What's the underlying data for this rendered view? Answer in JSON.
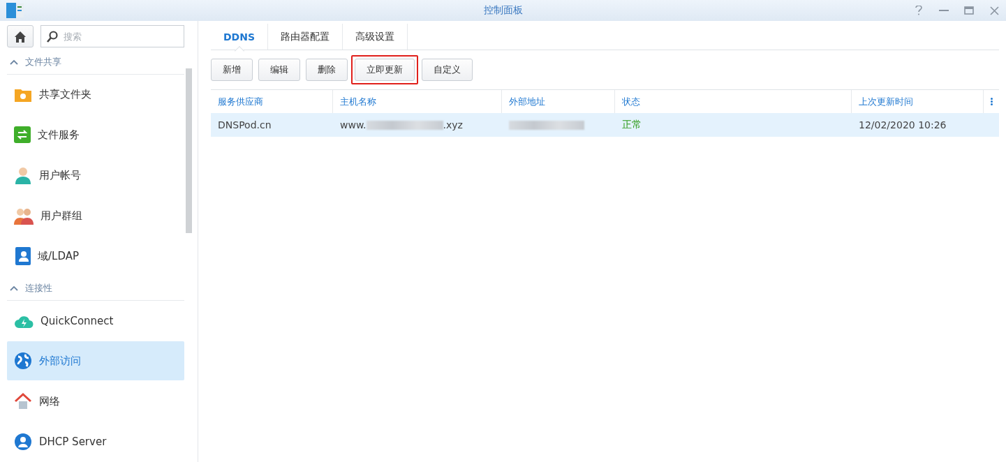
{
  "window": {
    "title": "控制面板"
  },
  "search": {
    "placeholder": "搜索"
  },
  "sidebar": {
    "sections": [
      {
        "header": "文件共享",
        "expanded": true,
        "items": [
          {
            "label": "共享文件夹",
            "selected": false
          },
          {
            "label": "文件服务",
            "selected": false
          },
          {
            "label": "用户帐号",
            "selected": false
          },
          {
            "label": "用户群组",
            "selected": false
          },
          {
            "label": "域/LDAP",
            "selected": false
          }
        ]
      },
      {
        "header": "连接性",
        "expanded": true,
        "items": [
          {
            "label": "QuickConnect",
            "selected": false
          },
          {
            "label": "外部访问",
            "selected": true
          },
          {
            "label": "网络",
            "selected": false
          },
          {
            "label": "DHCP Server",
            "selected": false
          }
        ]
      }
    ]
  },
  "tabs": [
    {
      "label": "DDNS",
      "selected": true
    },
    {
      "label": "路由器配置",
      "selected": false
    },
    {
      "label": "高级设置",
      "selected": false
    }
  ],
  "toolbar": [
    {
      "label": "新增",
      "highlighted": false
    },
    {
      "label": "编辑",
      "highlighted": false
    },
    {
      "label": "删除",
      "highlighted": false
    },
    {
      "label": "立即更新",
      "highlighted": true
    },
    {
      "label": "自定义",
      "highlighted": false
    }
  ],
  "table": {
    "columns": [
      "服务供应商",
      "主机名称",
      "外部地址",
      "状态",
      "上次更新时间"
    ],
    "rows": [
      {
        "provider": "DNSPod.cn",
        "host_prefix": "www.",
        "host_suffix": ".xyz",
        "status": "正常",
        "status_ok": true,
        "updated": "12/02/2020 10:26",
        "selected": true
      }
    ]
  }
}
